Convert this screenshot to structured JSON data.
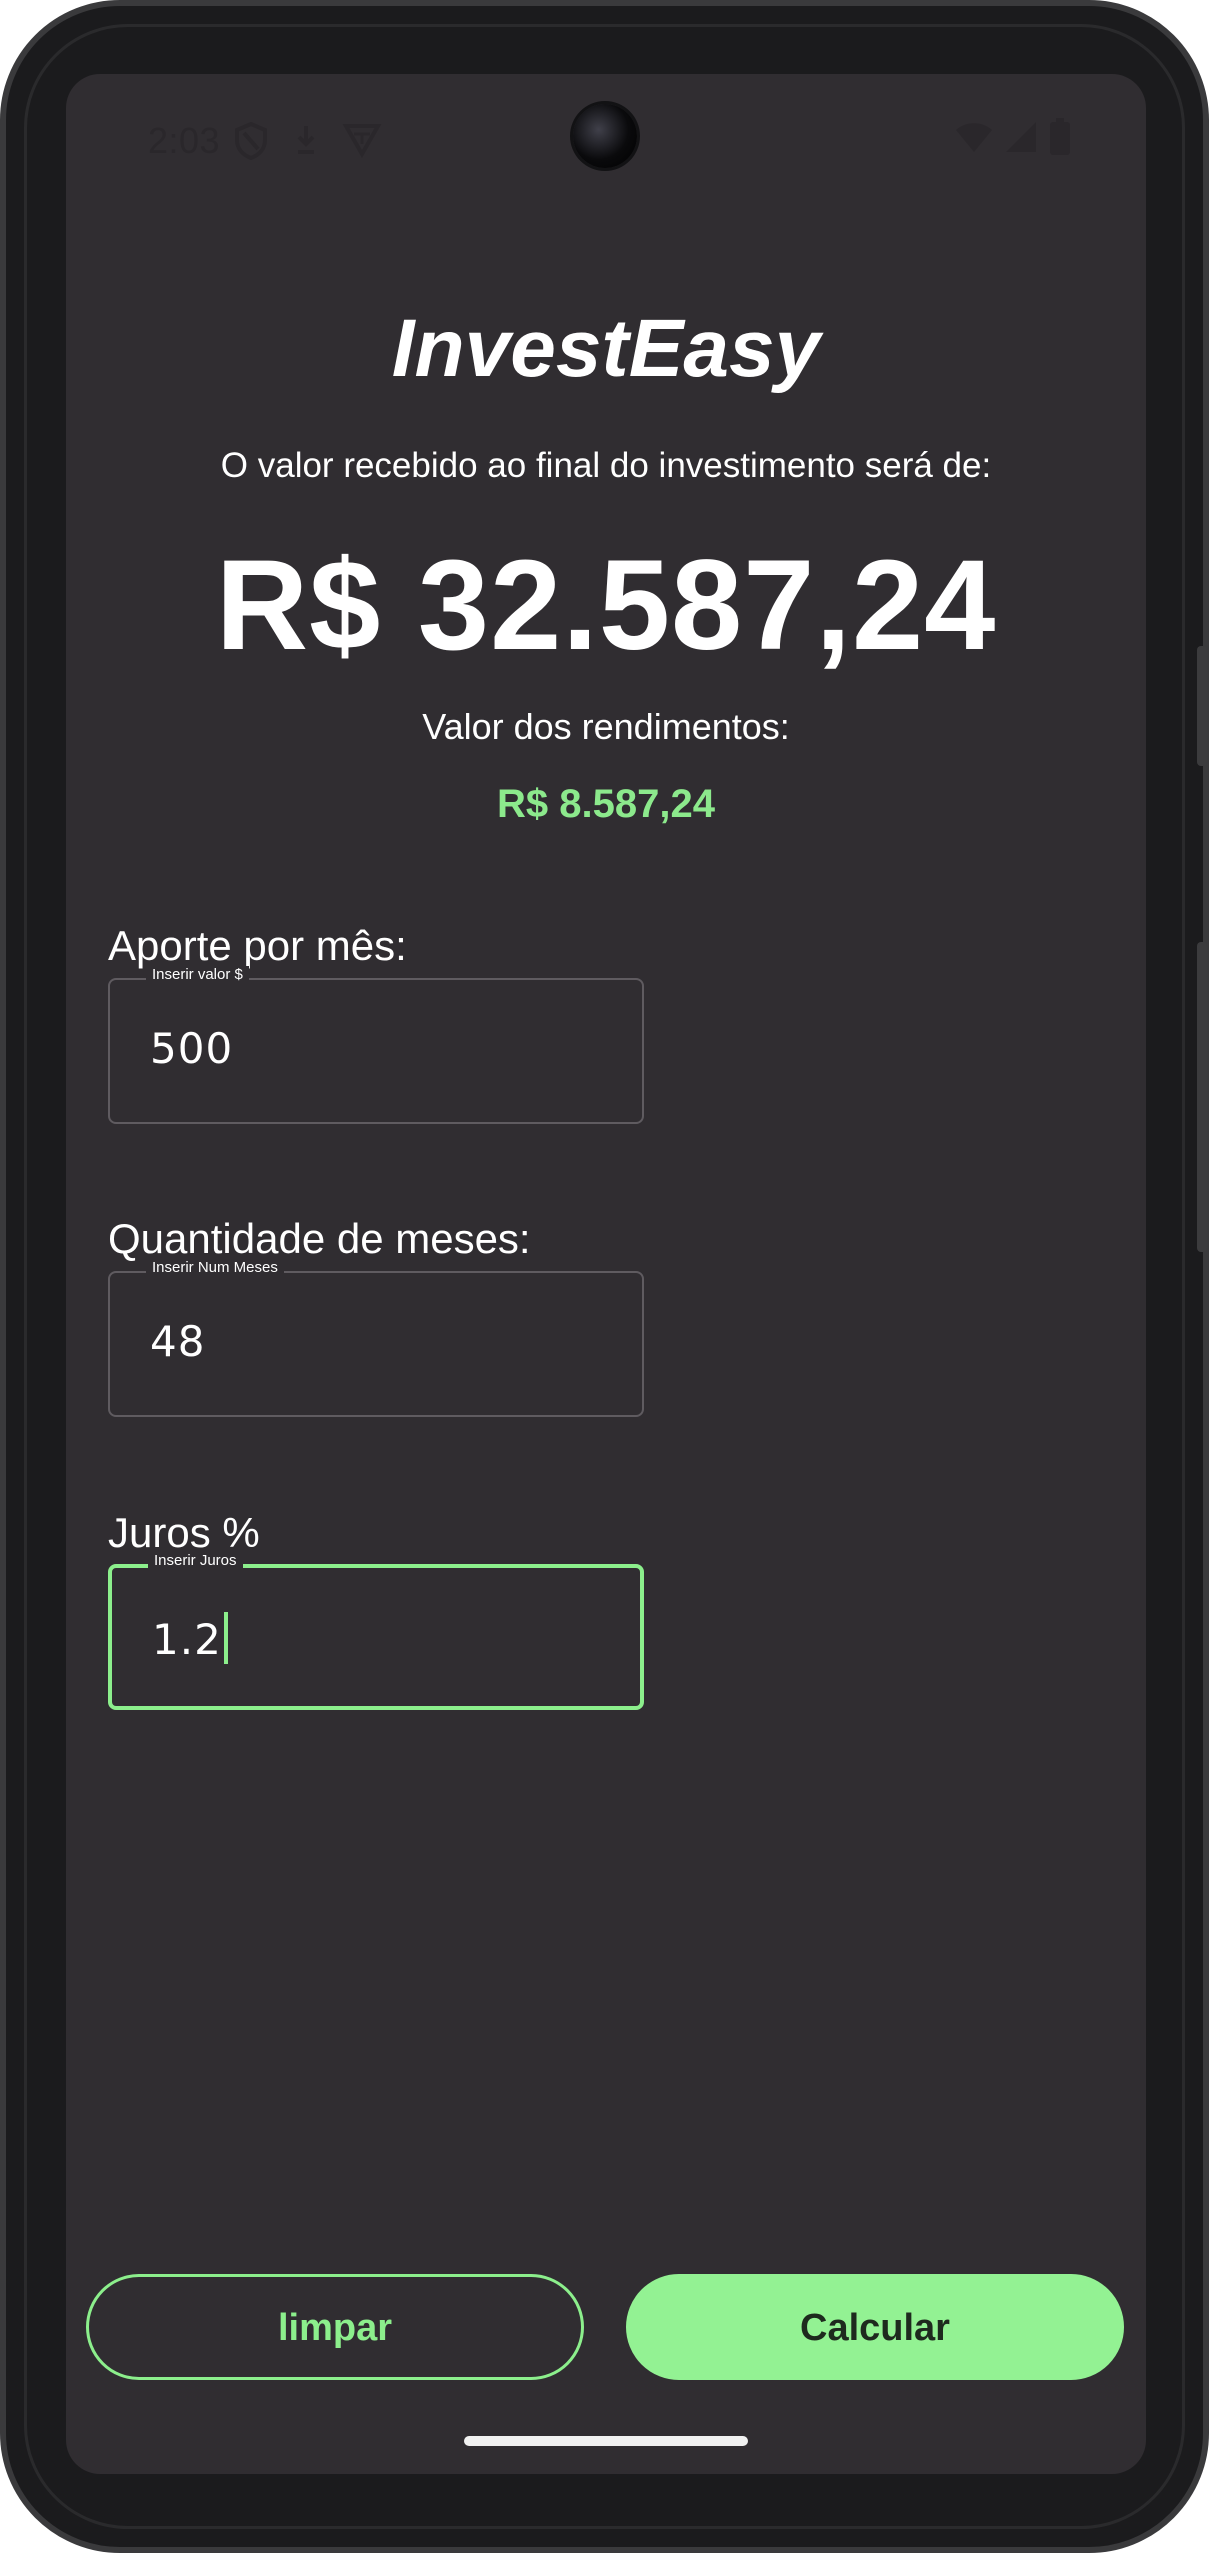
{
  "status": {
    "time": "2:03"
  },
  "app": {
    "title": "InvestEasy",
    "subtitle": "O valor recebido ao final do investimento será de:",
    "total_value": "R$ 32.587,24",
    "earnings_label": "Valor dos rendimentos:",
    "earnings_value": "R$ 8.587,24"
  },
  "form": {
    "monthly": {
      "label": "Aporte por mês:",
      "hint": "Inserir valor $",
      "value": "500"
    },
    "months": {
      "label": "Quantidade de meses:",
      "hint": "Inserir Num Meses",
      "value": "48"
    },
    "interest": {
      "label": "Juros %",
      "hint": "Inserir Juros",
      "value": "1.2"
    }
  },
  "buttons": {
    "clear": "limpar",
    "calculate": "Calcular"
  },
  "colors": {
    "background": "#302d31",
    "accent": "#8cef8c",
    "text": "#ffffff"
  },
  "icons": [
    "shield-icon",
    "download-icon",
    "vpn-icon",
    "wifi-icon",
    "signal-icon",
    "battery-icon"
  ]
}
